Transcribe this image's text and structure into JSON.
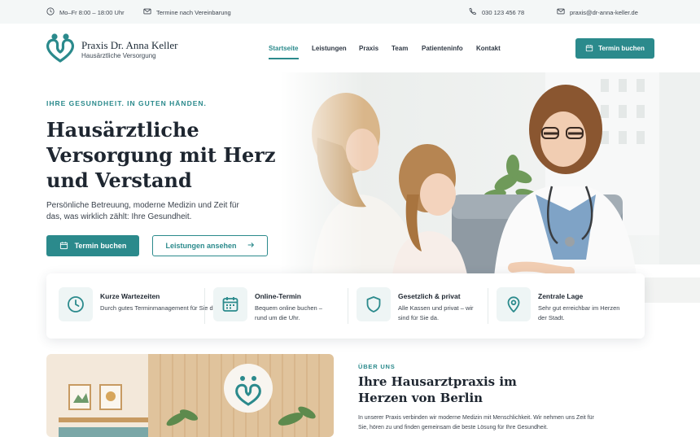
{
  "topbar": {
    "hours": "Mo–Fr 8:00 – 18:00 Uhr",
    "appointments": "Termine nach Vereinbarung",
    "phone": "030 123 456 78",
    "email": "praxis@dr-anna-keller.de"
  },
  "header": {
    "brand_name": "Praxis Dr. Anna Keller",
    "brand_sub": "Hausärztliche Versorgung",
    "nav": [
      "Startseite",
      "Leistungen",
      "Praxis",
      "Team",
      "Patienteninfo",
      "Kontakt"
    ],
    "active_nav": "Startseite",
    "cta": "Termin buchen"
  },
  "hero": {
    "eyebrow": "IHRE GESUNDHEIT. IN GUTEN HÄNDEN.",
    "title": "Hausärztliche Versorgung mit Herz und Verstand",
    "text": "Persönliche Betreuung, moderne Medizin und Zeit für das, was wirklich zählt: Ihre Gesundheit.",
    "primary_button": "Termin buchen",
    "secondary_button": "Leistungen ansehen"
  },
  "features": [
    {
      "icon": "clock-icon",
      "title": "Kurze Wartezeiten",
      "text": "Durch gutes Terminmanagement für Sie da."
    },
    {
      "icon": "calendar-icon",
      "title": "Online-Termin",
      "text": "Bequem online buchen – rund um die Uhr."
    },
    {
      "icon": "shield-icon",
      "title": "Gesetzlich & privat",
      "text": "Alle Kassen und privat – wir sind für Sie da."
    },
    {
      "icon": "map-pin-icon",
      "title": "Zentrale Lage",
      "text": "Sehr gut erreichbar im Herzen der Stadt."
    }
  ],
  "about": {
    "eyebrow": "ÜBER UNS",
    "title": "Ihre Hausarztpraxis im Herzen von Berlin",
    "text": "In unserer Praxis verbinden wir moderne Medizin mit Menschlichkeit. Wir nehmen uns Zeit für Sie, hören zu und finden gemeinsam die beste Lösung für Ihre Gesundheit."
  },
  "colors": {
    "accent": "#2b8a8c",
    "topbar_bg": "#f4f7f7",
    "heading": "#1e2630"
  }
}
